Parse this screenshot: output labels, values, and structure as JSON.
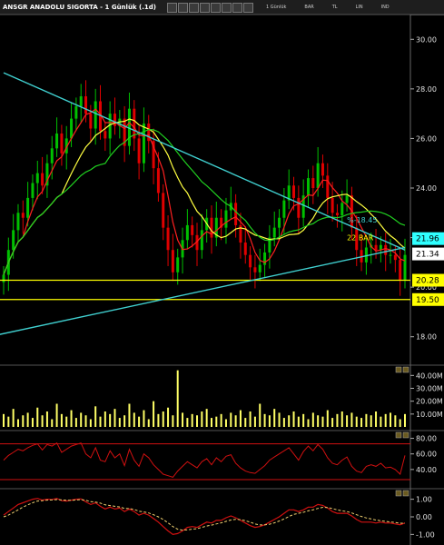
{
  "window": {
    "title": "ANSGR ANADOLU SIGORTA - 1 Günlük (.1d)",
    "menu": [
      "1 Günlük",
      "BAR",
      "TL",
      "LIN",
      "IND"
    ],
    "toolbar_icons": [
      "pointer-icon",
      "line-icon",
      "text-icon",
      "zoom-icon",
      "grid-icon",
      "color-icon",
      "settings-icon",
      "print-icon"
    ]
  },
  "colors": {
    "background": "#000000",
    "candle": "#00c000",
    "candle_down": "#e00000",
    "ma_short": "#ff2020",
    "ma_mid": "#ffff40",
    "ma_long": "#20d020",
    "trendline": "#40d0d0",
    "hline": "#ffff00",
    "volume": "#ffff66",
    "rsi": "#d01010",
    "macd": "#d01010",
    "macd_signal": "#f0d070"
  },
  "chart_data": [
    {
      "type": "candlestick",
      "panel": "price",
      "ylim": [
        17.0,
        31.0
      ],
      "ticks": [
        30.0,
        28.0,
        26.0,
        24.0,
        22.0,
        20.0,
        18.0
      ],
      "tick_labels": [
        "30.00",
        "28.00",
        "26.00",
        "24.00",
        "22.00",
        "20.00",
        "18.00"
      ],
      "close_series": [
        20.5,
        21.5,
        22.3,
        23.0,
        22.8,
        23.6,
        24.2,
        24.6,
        24.1,
        25.0,
        25.6,
        26.2,
        25.4,
        26.0,
        26.8,
        27.3,
        27.7,
        27.0,
        26.4,
        27.5,
        26.3,
        26.0,
        27.0,
        26.5,
        26.8,
        25.7,
        27.2,
        26.0,
        25.0,
        26.6,
        25.9,
        24.8,
        23.8,
        22.4,
        21.5,
        20.6,
        21.2,
        21.9,
        22.5,
        22.1,
        21.5,
        22.3,
        22.8,
        22.0,
        22.8,
        22.4,
        23.1,
        23.4,
        22.5,
        21.8,
        21.3,
        20.8,
        20.6,
        20.9,
        21.4,
        22.0,
        22.4,
        22.8,
        23.5,
        24.1,
        23.6,
        22.8,
        23.7,
        24.4,
        24.0,
        25.0,
        24.5,
        23.6,
        23.0,
        22.9,
        23.4,
        23.7,
        22.4,
        21.5,
        21.0,
        21.6,
        21.7,
        21.5,
        21.7,
        21.3,
        21.3,
        21.1,
        20.3,
        21.3
      ],
      "current_close": 21.34,
      "annotations": [
        {
          "text": "%-18.45",
          "price": 22.6
        },
        {
          "text": "22 BAR",
          "price": 21.9
        }
      ],
      "price_tags": [
        {
          "label": "21.96",
          "value": 21.96,
          "bg": "#30ffff"
        },
        {
          "label": "21.34",
          "value": 21.34,
          "bg": "#ffffff"
        },
        {
          "label": "20.28",
          "value": 20.28,
          "bg": "#ffff00"
        },
        {
          "label": "19.50",
          "value": 19.5,
          "bg": "#ffff00"
        }
      ],
      "horizontal_lines": [
        20.28,
        19.5
      ],
      "trendlines": [
        {
          "name": "resistance",
          "from": [
            0,
            28.65
          ],
          "to": [
            83,
            21.5
          ]
        },
        {
          "name": "support",
          "from": [
            -3,
            18.0
          ],
          "to": [
            83,
            21.6
          ]
        }
      ],
      "moving_averages": [
        "ma_short",
        "ma_mid",
        "ma_long"
      ]
    },
    {
      "type": "bar",
      "panel": "volume",
      "ylim": [
        0,
        48000000
      ],
      "ticks": [
        40000000,
        30000000,
        20000000,
        10000000
      ],
      "tick_labels": [
        "40.00M",
        "30.00M",
        "20.00M",
        "10.00M"
      ],
      "values_m": [
        10,
        8,
        14,
        6,
        9,
        11,
        7,
        15,
        9,
        12,
        6,
        18,
        10,
        8,
        13,
        7,
        11,
        9,
        6,
        16,
        8,
        12,
        10,
        14,
        7,
        9,
        18,
        11,
        8,
        13,
        6,
        20,
        10,
        12,
        15,
        9,
        44,
        11,
        7,
        10,
        9,
        12,
        14,
        7,
        8,
        10,
        6,
        11,
        9,
        13,
        7,
        12,
        8,
        18,
        10,
        9,
        14,
        11,
        7,
        9,
        12,
        8,
        10,
        6,
        11,
        9,
        8,
        13,
        7,
        10,
        12,
        9,
        11,
        8,
        7,
        10,
        9,
        12,
        8,
        10,
        11,
        9,
        6,
        10
      ]
    },
    {
      "type": "line",
      "panel": "rsi",
      "ylim": [
        20,
        90
      ],
      "ticks": [
        80,
        60,
        40
      ],
      "tick_labels": [
        "80.00",
        "60.00",
        "40.00"
      ],
      "bands": [
        73,
        27
      ],
      "values": [
        52,
        58,
        62,
        66,
        64,
        68,
        71,
        73,
        65,
        72,
        70,
        74,
        62,
        66,
        70,
        72,
        74,
        60,
        55,
        68,
        52,
        50,
        64,
        55,
        60,
        45,
        66,
        52,
        44,
        60,
        55,
        46,
        40,
        34,
        32,
        30,
        38,
        44,
        50,
        46,
        42,
        50,
        54,
        46,
        55,
        50,
        57,
        59,
        48,
        42,
        38,
        36,
        35,
        40,
        45,
        52,
        56,
        60,
        64,
        68,
        60,
        52,
        63,
        70,
        64,
        72,
        66,
        55,
        48,
        46,
        52,
        56,
        44,
        38,
        36,
        44,
        46,
        44,
        48,
        42,
        43,
        40,
        34,
        58
      ]
    },
    {
      "type": "line",
      "panel": "macd",
      "ylim": [
        -1.6,
        1.6
      ],
      "ticks": [
        1.0,
        0.0,
        -1.0
      ],
      "tick_labels": [
        "1.00",
        "0.00",
        "-1.00"
      ],
      "macd": [
        0.1,
        0.3,
        0.5,
        0.7,
        0.8,
        0.9,
        1.0,
        1.05,
        0.95,
        1.0,
        0.98,
        1.05,
        0.92,
        0.9,
        0.95,
        1.0,
        1.02,
        0.85,
        0.7,
        0.8,
        0.6,
        0.45,
        0.55,
        0.45,
        0.5,
        0.3,
        0.45,
        0.3,
        0.1,
        0.2,
        0.1,
        -0.1,
        -0.3,
        -0.55,
        -0.8,
        -1.0,
        -0.95,
        -0.8,
        -0.6,
        -0.55,
        -0.6,
        -0.45,
        -0.3,
        -0.35,
        -0.2,
        -0.2,
        -0.05,
        0.05,
        -0.05,
        -0.2,
        -0.35,
        -0.5,
        -0.6,
        -0.55,
        -0.45,
        -0.3,
        -0.15,
        0.0,
        0.2,
        0.4,
        0.4,
        0.3,
        0.4,
        0.55,
        0.55,
        0.7,
        0.65,
        0.5,
        0.3,
        0.2,
        0.2,
        0.2,
        0.05,
        -0.15,
        -0.3,
        -0.3,
        -0.3,
        -0.35,
        -0.3,
        -0.35,
        -0.35,
        -0.4,
        -0.45,
        -0.35
      ],
      "signal": [
        0.0,
        0.1,
        0.25,
        0.4,
        0.55,
        0.68,
        0.8,
        0.9,
        0.92,
        0.95,
        0.96,
        0.98,
        0.96,
        0.94,
        0.94,
        0.96,
        0.98,
        0.94,
        0.86,
        0.84,
        0.78,
        0.68,
        0.64,
        0.6,
        0.56,
        0.48,
        0.47,
        0.42,
        0.32,
        0.28,
        0.22,
        0.12,
        0.0,
        -0.15,
        -0.34,
        -0.55,
        -0.7,
        -0.76,
        -0.74,
        -0.7,
        -0.67,
        -0.6,
        -0.52,
        -0.47,
        -0.4,
        -0.34,
        -0.26,
        -0.18,
        -0.14,
        -0.16,
        -0.22,
        -0.3,
        -0.4,
        -0.46,
        -0.46,
        -0.42,
        -0.34,
        -0.24,
        -0.12,
        0.02,
        0.14,
        0.2,
        0.26,
        0.34,
        0.4,
        0.48,
        0.54,
        0.53,
        0.47,
        0.4,
        0.34,
        0.3,
        0.22,
        0.12,
        0.02,
        -0.06,
        -0.12,
        -0.18,
        -0.22,
        -0.26,
        -0.29,
        -0.32,
        -0.36,
        -0.36
      ]
    }
  ]
}
